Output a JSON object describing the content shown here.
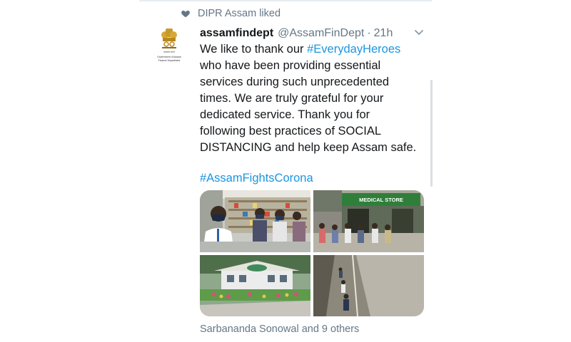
{
  "liked_by": {
    "text": "DIPR Assam liked"
  },
  "tweet": {
    "author_name": "assamfindept",
    "handle": "@AssamFinDept",
    "separator": "·",
    "time": "21h",
    "text_lines": [
      [
        "We like to thank our ",
        "#EverydayHeroes"
      ],
      [
        "who have been providing essential"
      ],
      [
        "services during such unprecedented"
      ],
      [
        "times. We are truly grateful for your"
      ],
      [
        "dedicated service. Thank you for"
      ],
      [
        "following best practices of SOCIAL"
      ],
      [
        "DISTANCING and help keep Assam safe."
      ]
    ],
    "hashtag": "#AssamFightsCorona",
    "likes_text": "Sarbananda Sonowal and 9 others"
  },
  "avatar": {
    "icon": "government-emblem-icon",
    "caption_line1": "Government of Assam",
    "caption_line2": "Finance Department"
  },
  "colors": {
    "link": "#1b95e0",
    "text": "#14171a",
    "secondary": "#657786",
    "emblem_gold": "#c89a2a"
  },
  "media": [
    {
      "name": "photo-pharmacy-staff"
    },
    {
      "name": "photo-medical-store-queue"
    },
    {
      "name": "photo-green-building"
    },
    {
      "name": "photo-empty-road"
    }
  ],
  "store_sign": "MEDICAL STORE"
}
